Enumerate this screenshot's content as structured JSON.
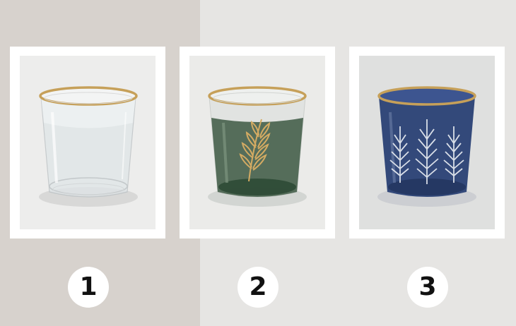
{
  "options": [
    {
      "number": "1",
      "glass_style": "clear glass with gold rim",
      "icon": "clear-glass-icon",
      "colors": {
        "panel": "#ededec",
        "glass": "#dfe5e7",
        "rim": "#c6a059"
      }
    },
    {
      "number": "2",
      "glass_style": "green glass with gold rim and gold leaf motif",
      "icon": "green-leaf-glass-icon",
      "colors": {
        "panel": "#ebebe9",
        "glass": "#4d6652",
        "rim": "#c6a059",
        "motif": "#d4ab63"
      }
    },
    {
      "number": "3",
      "glass_style": "navy blue glass with gold rim and white fern pattern",
      "icon": "blue-fern-glass-icon",
      "colors": {
        "panel": "#dfe0df",
        "glass": "#33497a",
        "rim": "#c6a059",
        "motif": "#e8ecf2"
      }
    }
  ]
}
